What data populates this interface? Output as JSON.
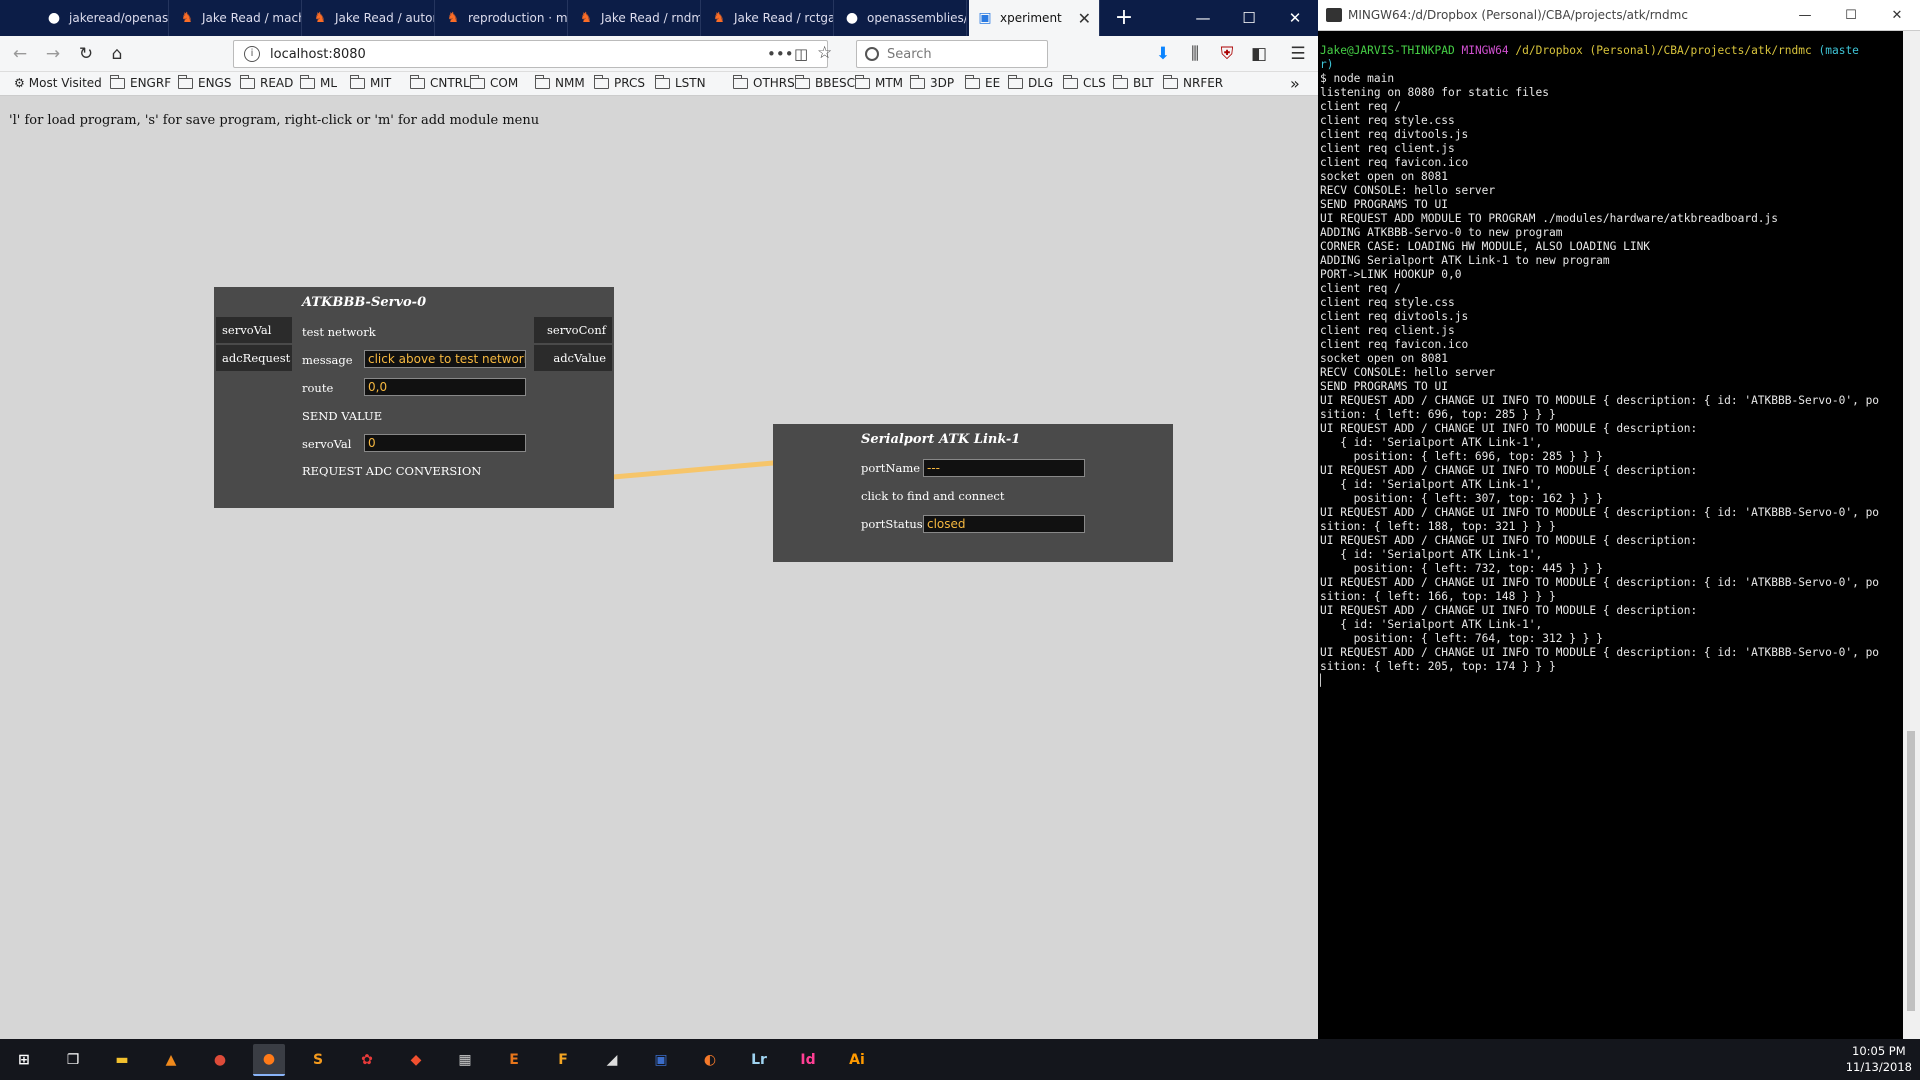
{
  "browser": {
    "tabs": [
      {
        "label": "jakeread/openasi",
        "icon": "github-icon",
        "color": "#ffffff"
      },
      {
        "label": "Jake Read / mach",
        "icon": "gitlab-icon",
        "color": "#fc6d26"
      },
      {
        "label": "Jake Read / auton",
        "icon": "gitlab-icon",
        "color": "#fc6d26"
      },
      {
        "label": "reproduction · m",
        "icon": "gitlab-icon",
        "color": "#fc6d26"
      },
      {
        "label": "Jake Read / rndm",
        "icon": "gitlab-icon",
        "color": "#fc6d26"
      },
      {
        "label": "Jake Read / rctga",
        "icon": "gitlab-icon",
        "color": "#fc6d26"
      },
      {
        "label": "openassemblies/",
        "icon": "github-icon",
        "color": "#ffffff"
      },
      {
        "label": "xperiment",
        "icon": "page-icon",
        "color": "#2a7ae2"
      }
    ],
    "url": "localhost:8080",
    "search_placeholder": "Search",
    "bookmarks": [
      "Most Visited",
      "ENGRF",
      "ENGS",
      "READ",
      "ML",
      "MIT",
      "CNTRL",
      "COM",
      "NMM",
      "PRCS",
      "LSTN",
      "OTHRS",
      "BBESC",
      "MTM",
      "3DP",
      "EE",
      "DLG",
      "CLS",
      "BLT",
      "NRFER"
    ]
  },
  "page": {
    "help_text": "'l' for load program, 's' for save program, right-click or 'm' for add module menu"
  },
  "modules": {
    "servo": {
      "title": "ATKBBB-Servo-0",
      "inputs": [
        "servoVal",
        "adcRequest"
      ],
      "outputs": [
        "servoConf",
        "adcValue"
      ],
      "test_network": "test network",
      "message_label": "message",
      "message_value": "click above to test network",
      "route_label": "route",
      "route_value": "0,0",
      "send_value": "SEND VALUE",
      "servoval_label": "servoVal",
      "servoval_value": "0",
      "adc_request": "REQUEST ADC CONVERSION"
    },
    "serial": {
      "title": "Serialport ATK Link-1",
      "portname_label": "portName",
      "portname_value": "---",
      "find_connect": "click to find and connect",
      "portstatus_label": "portStatus",
      "portstatus_value": "closed"
    },
    "wire_color": "#f6c56a"
  },
  "terminal": {
    "title": "MINGW64:/d/Dropbox (Personal)/CBA/projects/atk/rndmc",
    "prompt_user": "Jake@JARVIS-THINKPAD",
    "prompt_env": "MINGW64",
    "prompt_path": "/d/Dropbox (Personal)/CBA/projects/atk/rndmc",
    "prompt_branch": "(maste",
    "prompt_branch_wrap": "r)",
    "lines": [
      "$ node main",
      "listening on 8080 for static files",
      "client req /",
      "client req style.css",
      "client req divtools.js",
      "client req client.js",
      "client req favicon.ico",
      "socket open on 8081",
      "RECV CONSOLE: hello server",
      "SEND PROGRAMS TO UI",
      "UI REQUEST ADD MODULE TO PROGRAM ./modules/hardware/atkbreadboard.js",
      "ADDING ATKBBB-Servo-0 to new program",
      "CORNER CASE: LOADING HW MODULE, ALSO LOADING LINK",
      "ADDING Serialport ATK Link-1 to new program",
      "PORT->LINK HOOKUP 0,0",
      "client req /",
      "client req style.css",
      "client req divtools.js",
      "client req client.js",
      "client req favicon.ico",
      "socket open on 8081",
      "RECV CONSOLE: hello server",
      "SEND PROGRAMS TO UI",
      "UI REQUEST ADD / CHANGE UI INFO TO MODULE { description: { id: 'ATKBBB-Servo-0', po",
      "sition: { left: 696, top: 285 } } }",
      "UI REQUEST ADD / CHANGE UI INFO TO MODULE { description:",
      "   { id: 'Serialport ATK Link-1',",
      "     position: { left: 696, top: 285 } } }",
      "UI REQUEST ADD / CHANGE UI INFO TO MODULE { description:",
      "   { id: 'Serialport ATK Link-1',",
      "     position: { left: 307, top: 162 } } }",
      "UI REQUEST ADD / CHANGE UI INFO TO MODULE { description: { id: 'ATKBBB-Servo-0', po",
      "sition: { left: 188, top: 321 } } }",
      "UI REQUEST ADD / CHANGE UI INFO TO MODULE { description:",
      "   { id: 'Serialport ATK Link-1',",
      "     position: { left: 732, top: 445 } } }",
      "UI REQUEST ADD / CHANGE UI INFO TO MODULE { description: { id: 'ATKBBB-Servo-0', po",
      "sition: { left: 166, top: 148 } } }",
      "UI REQUEST ADD / CHANGE UI INFO TO MODULE { description:",
      "   { id: 'Serialport ATK Link-1',",
      "     position: { left: 764, top: 312 } } }",
      "UI REQUEST ADD / CHANGE UI INFO TO MODULE { description: { id: 'ATKBBB-Servo-0', po",
      "sition: { left: 205, top: 174 } } }"
    ]
  },
  "taskbar": {
    "apps": [
      {
        "name": "start-icon",
        "glyph": "⊞",
        "color": "#ffffff"
      },
      {
        "name": "task-view-icon",
        "glyph": "❐",
        "color": "#ffffff"
      },
      {
        "name": "file-explorer-icon",
        "glyph": "▬",
        "color": "#f3c12e"
      },
      {
        "name": "vlc-icon",
        "glyph": "▲",
        "color": "#f08a1c"
      },
      {
        "name": "chrome-icon",
        "glyph": "●",
        "color": "#dd4b39"
      },
      {
        "name": "firefox-icon",
        "glyph": "●",
        "color": "#ff7a18"
      },
      {
        "name": "sublime-icon",
        "glyph": "S",
        "color": "#f49a1d"
      },
      {
        "name": "app-red-icon",
        "glyph": "✿",
        "color": "#e83a3a"
      },
      {
        "name": "git-icon",
        "glyph": "◆",
        "color": "#f1502f"
      },
      {
        "name": "calculator-icon",
        "glyph": "▦",
        "color": "#cccccc"
      },
      {
        "name": "eagle-icon",
        "glyph": "E",
        "color": "#e8761b"
      },
      {
        "name": "fusion-icon",
        "glyph": "F",
        "color": "#f5a623"
      },
      {
        "name": "inkscape-icon",
        "glyph": "◢",
        "color": "#dddddd"
      },
      {
        "name": "spyder-icon",
        "glyph": "▣",
        "color": "#3b6cc8"
      },
      {
        "name": "blender-icon",
        "glyph": "◐",
        "color": "#f5792a"
      },
      {
        "name": "lightroom-icon",
        "glyph": "Lr",
        "color": "#9fd3f0"
      },
      {
        "name": "indesign-icon",
        "glyph": "Id",
        "color": "#ff3f94"
      },
      {
        "name": "illustrator-icon",
        "glyph": "Ai",
        "color": "#ff9a00"
      }
    ],
    "time": "10:05 PM",
    "date": "11/13/2018"
  }
}
